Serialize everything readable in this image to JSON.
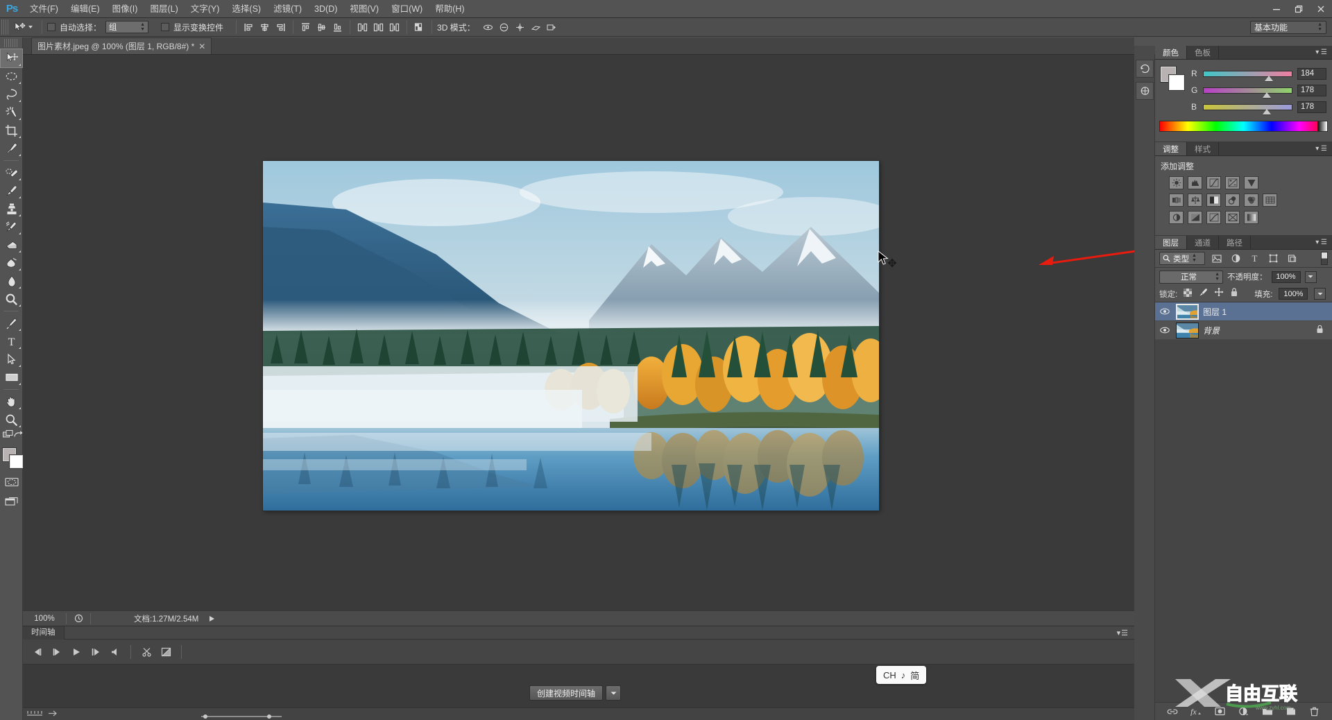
{
  "app": {
    "name": "Adobe Photoshop",
    "logo": "Ps"
  },
  "menubar": {
    "items": [
      {
        "label": "文件(F)",
        "name": "menu-file"
      },
      {
        "label": "编辑(E)",
        "name": "menu-edit"
      },
      {
        "label": "图像(I)",
        "name": "menu-image"
      },
      {
        "label": "图层(L)",
        "name": "menu-layer"
      },
      {
        "label": "文字(Y)",
        "name": "menu-type"
      },
      {
        "label": "选择(S)",
        "name": "menu-select"
      },
      {
        "label": "滤镜(T)",
        "name": "menu-filter"
      },
      {
        "label": "3D(D)",
        "name": "menu-3d"
      },
      {
        "label": "视图(V)",
        "name": "menu-view"
      },
      {
        "label": "窗口(W)",
        "name": "menu-window"
      },
      {
        "label": "帮助(H)",
        "name": "menu-help"
      }
    ],
    "window_controls": {
      "minimize": "—",
      "restore": "❐",
      "close": "✕"
    }
  },
  "options_bar": {
    "auto_select_label": "自动选择：",
    "auto_select_value": "组",
    "auto_select_checked": false,
    "show_transform_label": "显示变换控件",
    "show_transform_checked": false,
    "mode_3d_label": "3D 模式：",
    "workspace": "基本功能"
  },
  "tools": [
    {
      "name": "move-tool",
      "title": "移动工具",
      "selected": true
    },
    {
      "name": "marquee-tool",
      "title": "矩形选框工具",
      "selected": false
    },
    {
      "name": "lasso-tool",
      "title": "套索工具",
      "selected": false
    },
    {
      "name": "magic-wand-tool",
      "title": "魔棒工具",
      "selected": false
    },
    {
      "name": "crop-tool",
      "title": "裁剪工具",
      "selected": false
    },
    {
      "name": "eyedropper-tool",
      "title": "吸管工具",
      "selected": false
    },
    {
      "name": "healing-brush-tool",
      "title": "污点修复画笔工具",
      "selected": false
    },
    {
      "name": "brush-tool",
      "title": "画笔工具",
      "selected": false
    },
    {
      "name": "clone-stamp-tool",
      "title": "仿制图章工具",
      "selected": false
    },
    {
      "name": "history-brush-tool",
      "title": "历史记录画笔工具",
      "selected": false
    },
    {
      "name": "eraser-tool",
      "title": "橡皮擦工具",
      "selected": false
    },
    {
      "name": "gradient-tool",
      "title": "渐变工具",
      "selected": false
    },
    {
      "name": "blur-tool",
      "title": "模糊工具",
      "selected": false
    },
    {
      "name": "dodge-tool",
      "title": "减淡工具",
      "selected": false
    },
    {
      "name": "pen-tool",
      "title": "钢笔工具",
      "selected": false
    },
    {
      "name": "type-tool",
      "title": "横排文字工具",
      "selected": false
    },
    {
      "name": "path-selection-tool",
      "title": "路径选择工具",
      "selected": false
    },
    {
      "name": "rectangle-tool",
      "title": "矩形工具",
      "selected": false
    },
    {
      "name": "hand-tool",
      "title": "抓手工具",
      "selected": false
    },
    {
      "name": "zoom-tool",
      "title": "缩放工具",
      "selected": false
    }
  ],
  "document": {
    "tab_label": "图片素材.jpeg @ 100% (图层 1, RGB/8#) *",
    "close_glyph": "✕"
  },
  "status_bar": {
    "zoom": "100%",
    "doc_info": "文档:1.27M/2.54M"
  },
  "timeline": {
    "tab_label": "时间轴",
    "create_button": "创建视频时间轴",
    "transport": [
      "⏮",
      "◀|",
      "▶",
      "|▶",
      "◀"
    ],
    "extra": [
      "✂",
      "◩"
    ]
  },
  "ime": {
    "lang": "CH",
    "glyph": "♪",
    "mode": "简"
  },
  "right_dock": {
    "color_panel": {
      "tabs": [
        {
          "label": "颜色",
          "active": true
        },
        {
          "label": "色板",
          "active": false
        }
      ],
      "channels": [
        {
          "label": "R",
          "value": "184",
          "pos": 72
        },
        {
          "label": "G",
          "value": "178",
          "pos": 70
        },
        {
          "label": "B",
          "value": "178",
          "pos": 70
        }
      ],
      "foreground": "#b8b2b2",
      "background": "#ffffff"
    },
    "adjustments_panel": {
      "tabs": [
        {
          "label": "调整",
          "active": true
        },
        {
          "label": "样式",
          "active": false
        }
      ],
      "title": "添加调整",
      "icons": [
        [
          "brightness-contrast-icon",
          "levels-icon",
          "curves-icon",
          "exposure-icon",
          "vibrance-icon"
        ],
        [
          "hue-saturation-icon",
          "color-balance-icon",
          "black-white-icon",
          "photo-filter-icon",
          "channel-mixer-icon",
          "color-lookup-icon"
        ],
        [
          "invert-icon",
          "posterize-icon",
          "threshold-icon",
          "selective-color-icon",
          "gradient-map-icon"
        ]
      ]
    },
    "layers_panel": {
      "tabs": [
        {
          "label": "图层",
          "active": true
        },
        {
          "label": "通道",
          "active": false
        },
        {
          "label": "路径",
          "active": false
        }
      ],
      "filter_kind": "类型",
      "blend_mode": "正常",
      "opacity_label": "不透明度：",
      "opacity_value": "100%",
      "lock_label": "锁定:",
      "fill_label": "填充:",
      "fill_value": "100%",
      "layers": [
        {
          "name": "图层 1",
          "selected": true,
          "locked": false,
          "visible": true,
          "italic": false
        },
        {
          "name": "背景",
          "selected": false,
          "locked": true,
          "visible": true,
          "italic": true
        }
      ],
      "bottom_buttons": [
        "link-icon",
        "fx-icon",
        "mask-icon",
        "adjustment-icon",
        "group-icon",
        "new-layer-icon",
        "delete-icon"
      ]
    }
  },
  "annotation": {
    "arrow_color": "#e81b0f"
  },
  "watermark": {
    "text": "自由互联",
    "x_letter": "X"
  },
  "colors": {
    "chrome": "#535353",
    "panel": "#454545",
    "canvas": "#3a3a3a",
    "accent_blue": "#3aa8e0",
    "selection": "#5a7194"
  }
}
